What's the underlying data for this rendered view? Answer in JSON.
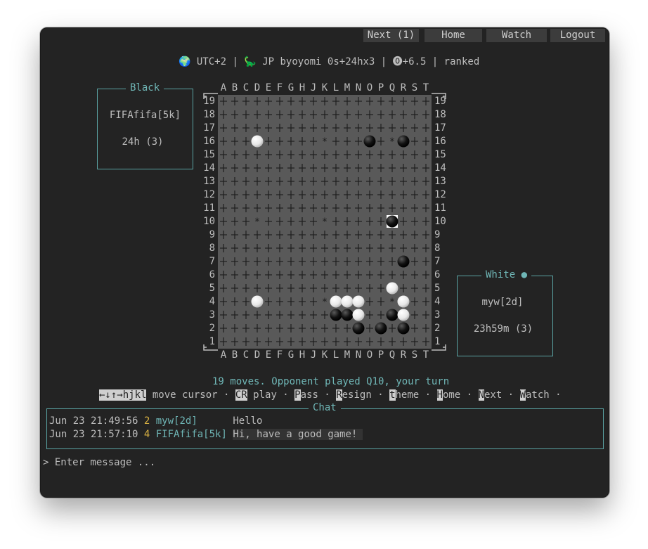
{
  "topbar": [
    {
      "label": "Next (1)",
      "name": "next-button"
    },
    {
      "label": "Home",
      "name": "home-button"
    },
    {
      "label": "Watch",
      "name": "watch-button"
    },
    {
      "label": "Logout",
      "name": "logout-button"
    }
  ],
  "info": {
    "globe": "🌍",
    "timezone": "UTC+2",
    "sep": " | ",
    "turtle": "🦕",
    "ruleset": "JP byoyomi 0s+24hx3",
    "komi_icon": "⓿",
    "komi": "+6.5",
    "ranked": "ranked"
  },
  "black": {
    "title": "Black",
    "player": "FIFAfifa[5k]",
    "time": "24h (3)"
  },
  "white": {
    "title": "White",
    "turn_dot": "●",
    "player": "myw[2d]",
    "time": "23h59m (3)"
  },
  "board": {
    "columns": [
      "A",
      "B",
      "C",
      "D",
      "E",
      "F",
      "G",
      "H",
      "J",
      "K",
      "L",
      "M",
      "N",
      "O",
      "P",
      "Q",
      "R",
      "S",
      "T"
    ],
    "rows": [
      "19",
      "18",
      "17",
      "16",
      "15",
      "14",
      "13",
      "12",
      "11",
      "10",
      "9",
      "8",
      "7",
      "6",
      "5",
      "4",
      "3",
      "2",
      "1"
    ],
    "hoshi_mark": "*",
    "hoshi": [
      "D16",
      "K16",
      "Q16",
      "D10",
      "K10",
      "Q10",
      "D4",
      "K4",
      "Q4"
    ],
    "last_move": "Q10",
    "black_stones": [
      "O16",
      "R16",
      "Q10",
      "R7",
      "L3",
      "M3",
      "Q3",
      "N2",
      "P2",
      "R2"
    ],
    "white_stones": [
      "D16",
      "Q5",
      "D4",
      "L4",
      "M4",
      "N4",
      "R4",
      "N3",
      "R3"
    ]
  },
  "status": "19 moves. Opponent played Q10, your turn",
  "help": {
    "arrows_key": "←↓↑→hjkl",
    "arrows_text": " move cursor · ",
    "cr_key": "CR",
    "cr_text": " play · ",
    "p_key": "P",
    "p_text": "ass · ",
    "r_key": "R",
    "r_text": "esign · ",
    "t_key": "t",
    "t_text": "heme · ",
    "h_key": "H",
    "h_text": "ome · ",
    "n_key": "N",
    "n_text": "ext · ",
    "w_key": "W",
    "w_text": "atch ·"
  },
  "chat": {
    "title": "Chat",
    "messages": [
      {
        "time": "Jun 23 21:49:56",
        "num": "2",
        "user": "myw[2d]     ",
        "text": "Hello"
      },
      {
        "time": "Jun 23 21:57:10",
        "num": "4",
        "user": "FIFAfifa[5k]",
        "text": "Hi, have a good game!"
      }
    ]
  },
  "input": {
    "prompt": "> ",
    "placeholder": "Enter message ..."
  },
  "colors": {
    "accent": "#6fb6b6",
    "board": "#595959",
    "background": "#232323",
    "highlight": "#d7b042"
  }
}
